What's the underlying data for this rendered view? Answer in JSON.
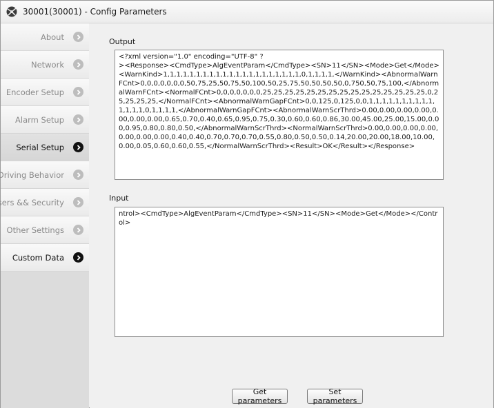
{
  "window": {
    "title": "30001(30001) - Config Parameters"
  },
  "sidebar": {
    "items": [
      {
        "label": "About",
        "state": "normal"
      },
      {
        "label": "Network",
        "state": "normal"
      },
      {
        "label": "Encoder Setup",
        "state": "normal"
      },
      {
        "label": "Alarm Setup",
        "state": "normal"
      },
      {
        "label": "Serial Setup",
        "state": "active"
      },
      {
        "label": "Driving Behavior",
        "state": "normal"
      },
      {
        "label": "Users && Security",
        "state": "normal"
      },
      {
        "label": "Other Settings",
        "state": "normal"
      },
      {
        "label": "Custom Data",
        "state": "dark"
      }
    ]
  },
  "main": {
    "output_label": "Output",
    "output_text": "<?xml version=\"1.0\" encoding=\"UTF-8\" ?\n><Response><CmdType>AlgEventParam</CmdType><SN>11</SN><Mode>Get</Mode><WarnKind>1,1,1,1,1,1,1,1,1,1,1,1,1,1,1,1,1,1,1,1,1,0,1,1,1,1,</WarnKind><AbnormalWarnFCnt>0,0,0,0,0,0,0,50,75,25,50,75,50,100,50,25,75,50,50,50,50,0,750,50,75,100,</AbnormalWarnFCnt><NormalFCnt>0,0,0,0,0,0,0,25,25,25,25,25,25,25,25,25,25,25,25,25,25,25,0,25,25,25,25,</NormalFCnt><AbnormalWarnGapFCnt>0,0,125,0,125,0,0,1,1,1,1,1,1,1,1,1,1,1,1,1,1,0,1,1,1,1,</AbnormalWarnGapFCnt><AbnormalWarnScrThrd>0.00,0.00,0.00,0.00,0.00,0.00,0.00,0.65,0.70,0.40,0.65,0.95,0.75,0.30,0.60,0.60,0.86,30.00,45.00,25.00,15.00,0.00,0.95,0.80,0.80,0.50,</AbnormalWarnScrThrd><NormalWarnScrThrd>0.00,0.00,0.00,0.00,0.00,0.00,0.00,0.40,0.40,0.70,0.70,0.70,0.55,0.80,0.50,0.50,0.14,20.00,20.00,18.00,10.00,0.00,0.05,0.60,0.60,0.55,</NormalWarnScrThrd><Result>OK</Result></Response>",
    "input_label": "Input",
    "input_text": "ntrol><CmdType>AlgEventParam</CmdType><SN>11</SN><Mode>Get</Mode></Control>",
    "get_button": "Get parameters",
    "set_button": "Set parameters"
  }
}
